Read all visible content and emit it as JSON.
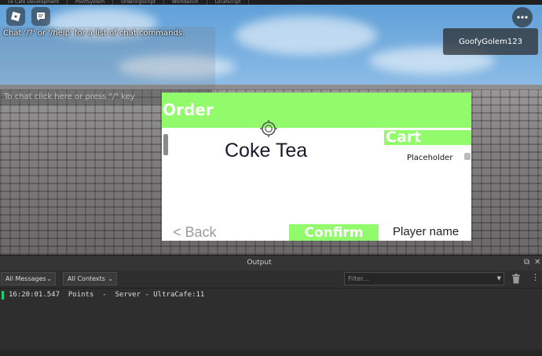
{
  "studio_tabs": [
    "ce Cafe Development",
    "PointSystem",
    "OrderingScript",
    "Workbench",
    "LocalScript"
  ],
  "chat": {
    "system_message": "Chat '/?' or '/help' for a list of chat commands.",
    "input_placeholder": "To chat click here or press \"/\" key"
  },
  "player": {
    "username": "GoofyGolem123"
  },
  "order_gui": {
    "title": "Order",
    "item_name": "Coke Tea",
    "cart_title": "Cart",
    "cart_item": "Placeholder",
    "back_label": "< Back",
    "confirm_label": "Confirm",
    "player_name_label": "Player name",
    "accent_color": "#91fb6b"
  },
  "output": {
    "title": "Output",
    "messages_filter": "All Messages",
    "contexts_filter": "All Contexts",
    "filter_placeholder": "Filter...",
    "log": [
      {
        "time": "16:20:01.547",
        "message": "Points",
        "sep": "-",
        "source": "Server - UltraCafe:11"
      }
    ]
  }
}
